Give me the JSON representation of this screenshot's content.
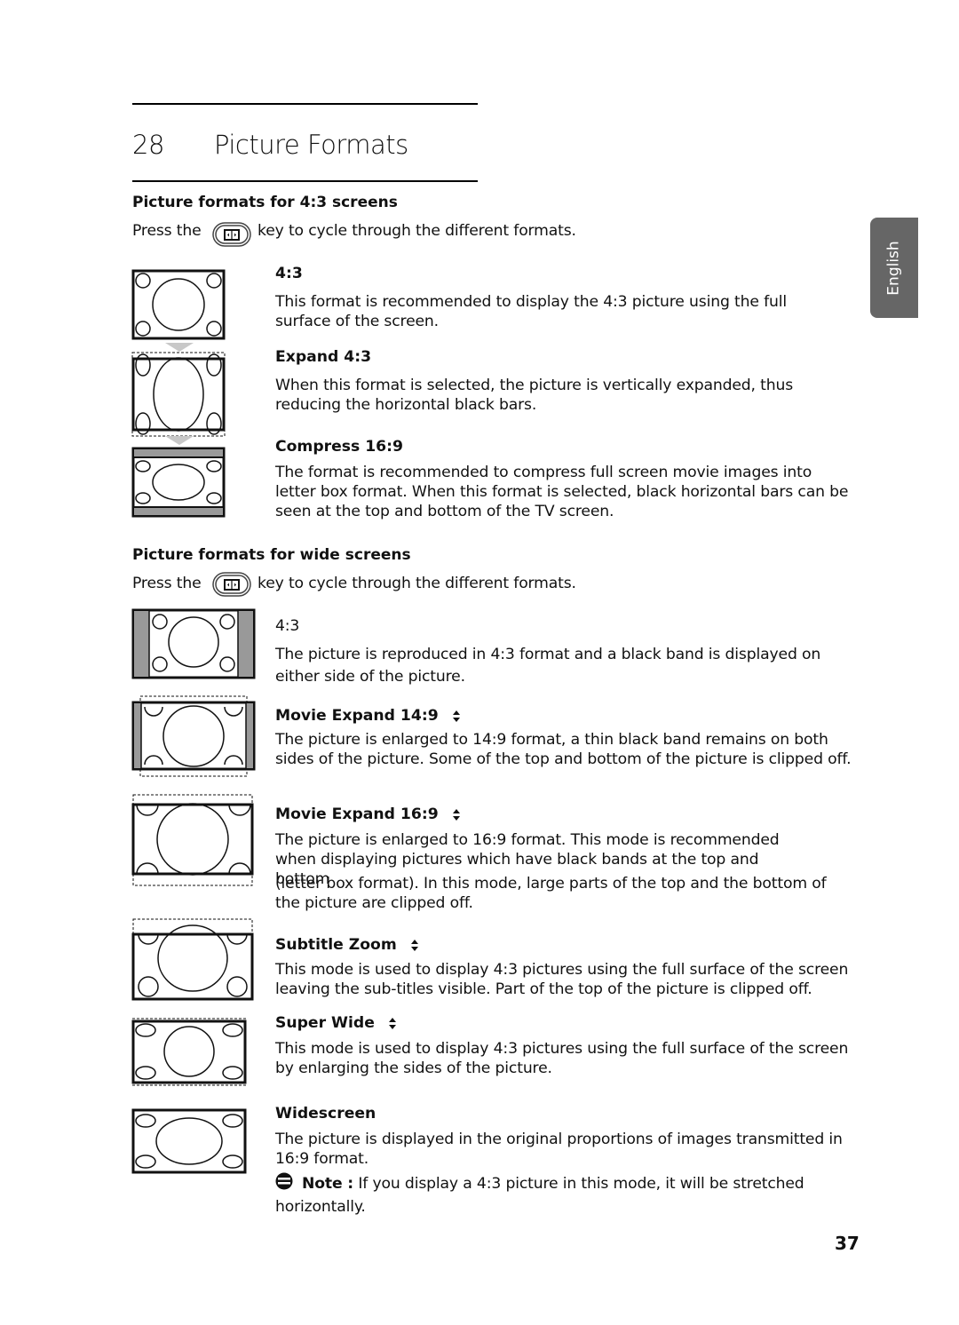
{
  "chapter": {
    "number": "28",
    "title": "Picture Formats"
  },
  "language_tab": "English",
  "page_number": "37",
  "section_43": {
    "heading": "Picture formats for 4:3 screens",
    "press_prefix": "Press the",
    "press_suffix": "key to cycle through the different formats.",
    "key_icon": "format-key-icon",
    "items": [
      {
        "title": "4:3",
        "text": "This format is recommended to display the 4:3 picture using the full surface of the screen."
      },
      {
        "title": "Expand 4:3",
        "text": "When this format is selected, the picture is vertically expanded, thus reducing the horizontal black bars."
      },
      {
        "title": "Compress 16:9",
        "text": "The format is recommended to compress full screen movie images into letter box format. When this format is selected, black horizontal bars can be seen at the top and bottom of the TV screen."
      }
    ]
  },
  "section_wide": {
    "heading": "Picture formats for wide screens",
    "press_prefix": "Press the",
    "press_suffix": "key to cycle through the different formats.",
    "key_icon": "format-key-icon",
    "items": [
      {
        "title": "4:3",
        "text": "The picture is reproduced in 4:3 format and a black band is displayed on either side of the picture.",
        "updown_icon": false
      },
      {
        "title": "Movie Expand 14:9",
        "text": "The picture is enlarged to 14:9 format, a thin black band remains on both sides of the picture. Some of the top and bottom of the picture is clipped off.",
        "updown_icon": true
      },
      {
        "title": "Movie Expand 16:9",
        "text1": "The picture is enlarged to 16:9 format. This mode is recommended when displaying pictures which have black bands at the top and bottom",
        "text2": "(letter box format). In this mode, large parts of the top and the bottom of the picture are clipped off.",
        "updown_icon": true
      },
      {
        "title": "Subtitle Zoom",
        "text": "This mode is used to display 4:3 pictures using the full surface of the screen leaving the sub-titles visible. Part of the top of the picture is clipped off.",
        "updown_icon": true
      },
      {
        "title": "Super Wide",
        "text": "This mode is used to display 4:3 pictures using the full surface of the screen by enlarging the sides of the picture.",
        "updown_icon": true
      },
      {
        "title": "Widescreen",
        "text": "The picture is displayed in the original proportions of images transmitted in 16:9 format.",
        "updown_icon": false
      }
    ],
    "note": {
      "label": "Note :",
      "text": "If you display a 4:3 picture in this mode, it will be stretched horizontally."
    }
  },
  "colors": {
    "band_gray": "#999999",
    "tab_gray": "#666666",
    "arrow_gray": "#c8c8c8"
  }
}
